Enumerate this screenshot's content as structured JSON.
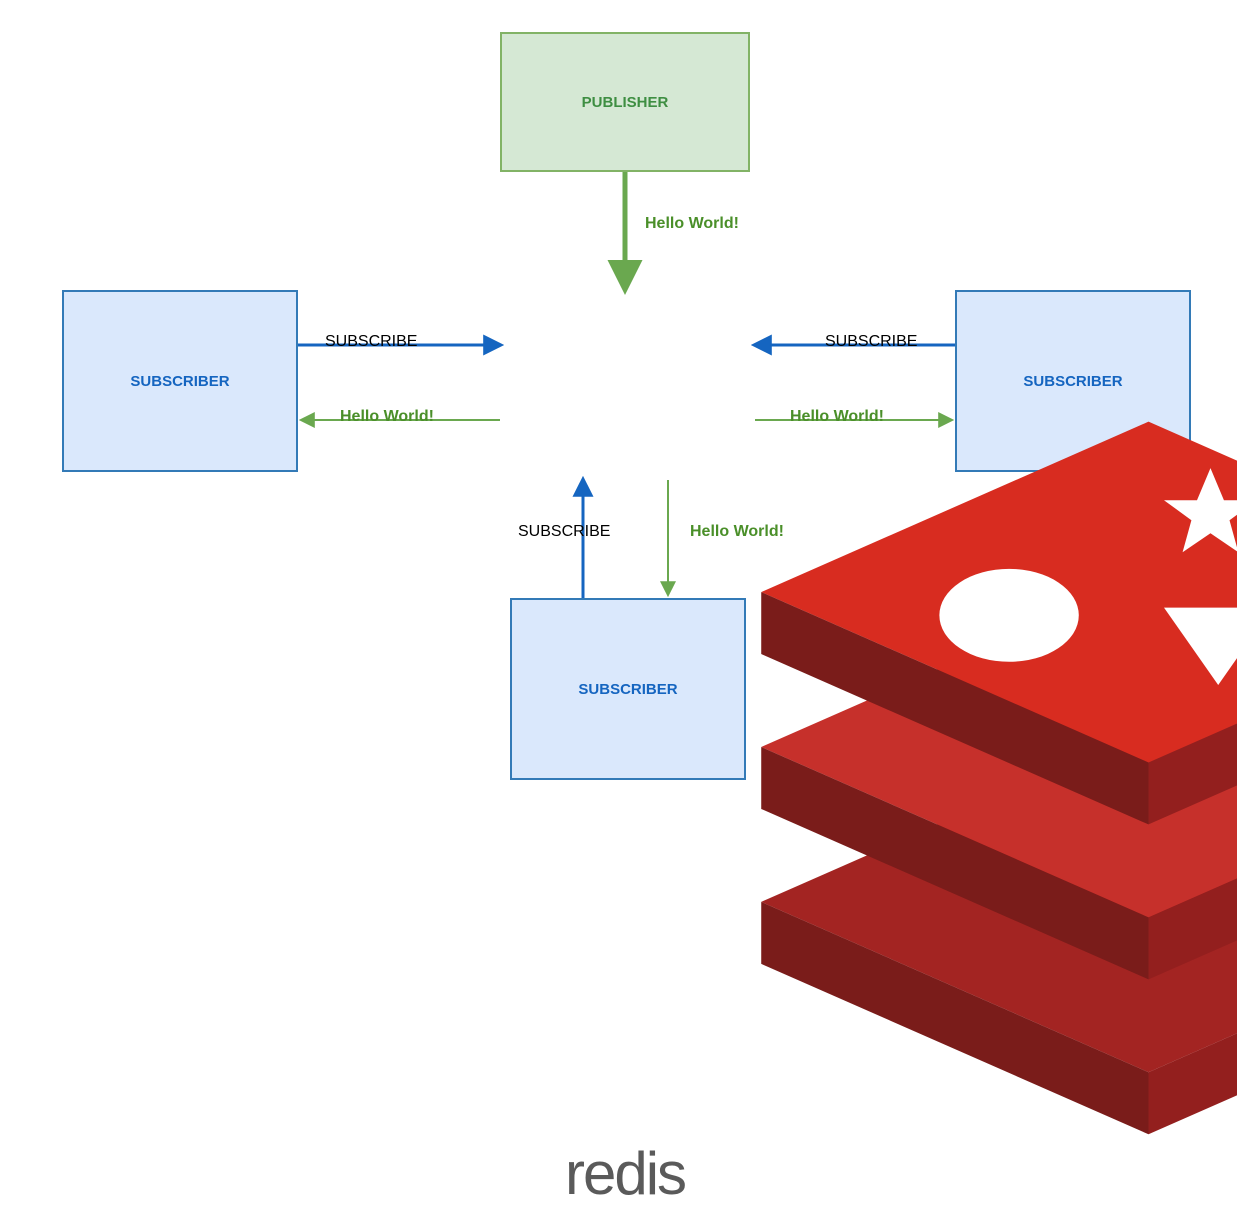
{
  "publisher": {
    "label": "PUBLISHER"
  },
  "subscribers": {
    "left": {
      "label": "SUBSCRIBER"
    },
    "right": {
      "label": "SUBSCRIBER"
    },
    "bottom": {
      "label": "SUBSCRIBER"
    }
  },
  "center": {
    "name": "redis"
  },
  "messages": {
    "publish": "Hello World!",
    "subscribe": "SUBSCRIBE",
    "broadcast_left": "Hello World!",
    "broadcast_right": "Hello World!",
    "broadcast_bottom": "Hello World!"
  },
  "colors": {
    "publisher_fill": "#d5e8d4",
    "publisher_stroke": "#82b366",
    "subscriber_fill": "#dae8fc",
    "subscriber_stroke": "#337ab7",
    "arrow_subscribe": "#1565c0",
    "arrow_message": "#6aa84f"
  }
}
